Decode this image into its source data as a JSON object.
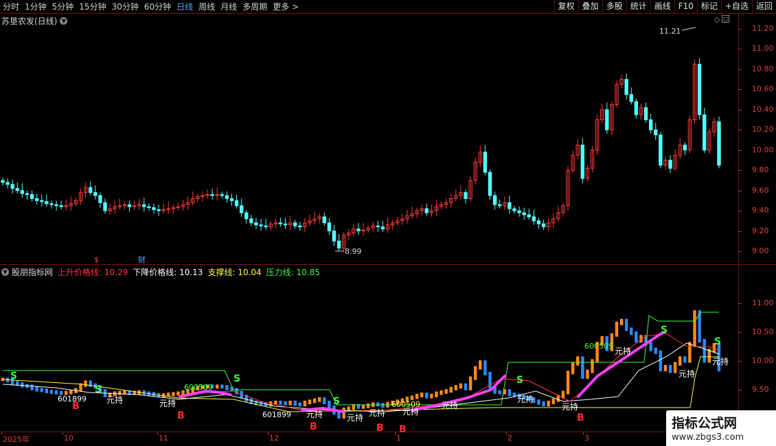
{
  "toolbar": {
    "timeframes": [
      "分时",
      "1分钟",
      "5分钟",
      "15分钟",
      "30分钟",
      "60分钟",
      "日线",
      "周线",
      "月线",
      "多周期",
      "更多 >"
    ],
    "active": "日线",
    "buttons": [
      "复权",
      "叠加",
      "多股",
      "统计",
      "画线",
      "F10",
      "标记",
      "+自选",
      "返回"
    ]
  },
  "main_panel": {
    "title": "苏垦农发(日线)",
    "high_marker": "11.21",
    "low_marker": "8.99",
    "y_ticks": [
      "11.20",
      "11.00",
      "10.80",
      "10.60",
      "10.40",
      "10.20",
      "10.00",
      "9.80",
      "9.60",
      "9.40",
      "9.20",
      "9.00"
    ],
    "event_markers": [
      "$",
      "财"
    ]
  },
  "indicator_panel": {
    "name": "股朋指标网",
    "values": [
      {
        "label": "上升价格线:",
        "value": "10.29",
        "color": "#ff3a3a"
      },
      {
        "label": "下降价格线:",
        "value": "10.13",
        "color": "#ffffff"
      },
      {
        "label": "支撑线:",
        "value": "10.04",
        "color": "#ffff3a"
      },
      {
        "label": "压力线:",
        "value": "10.85",
        "color": "#3aff3a"
      }
    ],
    "y_ticks": [
      "11.00",
      "10.50",
      "10.00",
      "9.50"
    ],
    "signal_labels": [
      "S",
      "B",
      "元持",
      "600509",
      "601899",
      "600509"
    ]
  },
  "x_axis": {
    "labels": [
      "2025年",
      "10",
      "11",
      "12",
      "1",
      "2",
      "3"
    ]
  },
  "watermark": {
    "title": "指标公式网",
    "url": "www.zbgs3.com"
  },
  "colors": {
    "up": "#ff3a3a",
    "down": "#54ffff",
    "border": "#7a1010",
    "active_tab": "#4fa8ff",
    "magenta": "#ff40ff",
    "blue_bar": "#2a8cff",
    "orange_bar": "#ff8c1a"
  }
}
